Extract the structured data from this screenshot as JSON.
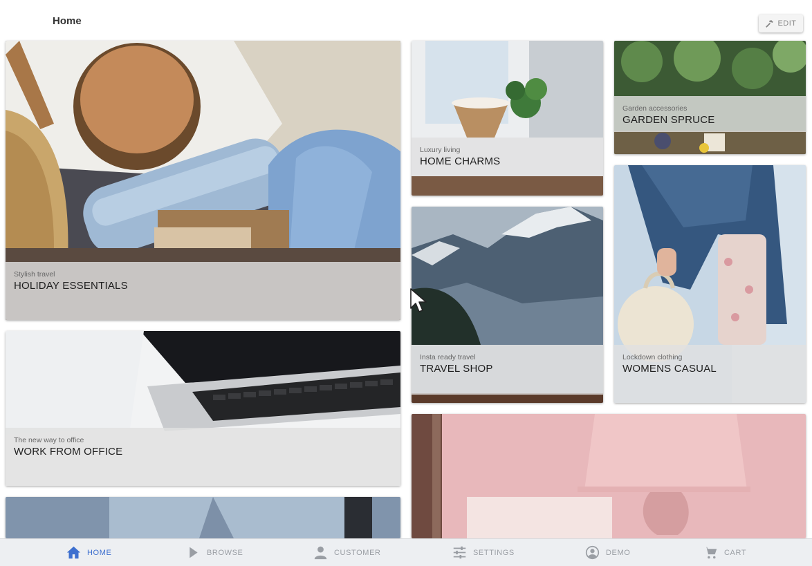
{
  "header": {
    "title": "Home",
    "edit_label": "EDIT"
  },
  "tiles": [
    {
      "subtitle": "Stylish travel",
      "title": "HOLIDAY ESSENTIALS"
    },
    {
      "subtitle": "The new way to office",
      "title": "WORK FROM OFFICE"
    },
    {
      "subtitle": "Luxury living",
      "title": "HOME CHARMS"
    },
    {
      "subtitle": "Garden accessories",
      "title": "GARDEN SPRUCE"
    },
    {
      "subtitle": "Insta ready travel",
      "title": "TRAVEL SHOP"
    },
    {
      "subtitle": "Lockdown clothing",
      "title": "WOMENS CASUAL"
    }
  ],
  "nav": {
    "active": "home",
    "items": [
      {
        "id": "home",
        "label": "HOME",
        "icon": "home-icon"
      },
      {
        "id": "browse",
        "label": "BROWSE",
        "icon": "play-icon"
      },
      {
        "id": "customer",
        "label": "CUSTOMER",
        "icon": "person-icon"
      },
      {
        "id": "settings",
        "label": "SETTINGS",
        "icon": "sliders-icon"
      },
      {
        "id": "demo",
        "label": "DEMO",
        "icon": "account-circle-icon"
      },
      {
        "id": "cart",
        "label": "CART",
        "icon": "cart-icon"
      }
    ]
  },
  "colors": {
    "accent": "#3d6fcf",
    "nav_inactive": "#9a9ea4",
    "caption_bg": "#e1e1e1"
  }
}
